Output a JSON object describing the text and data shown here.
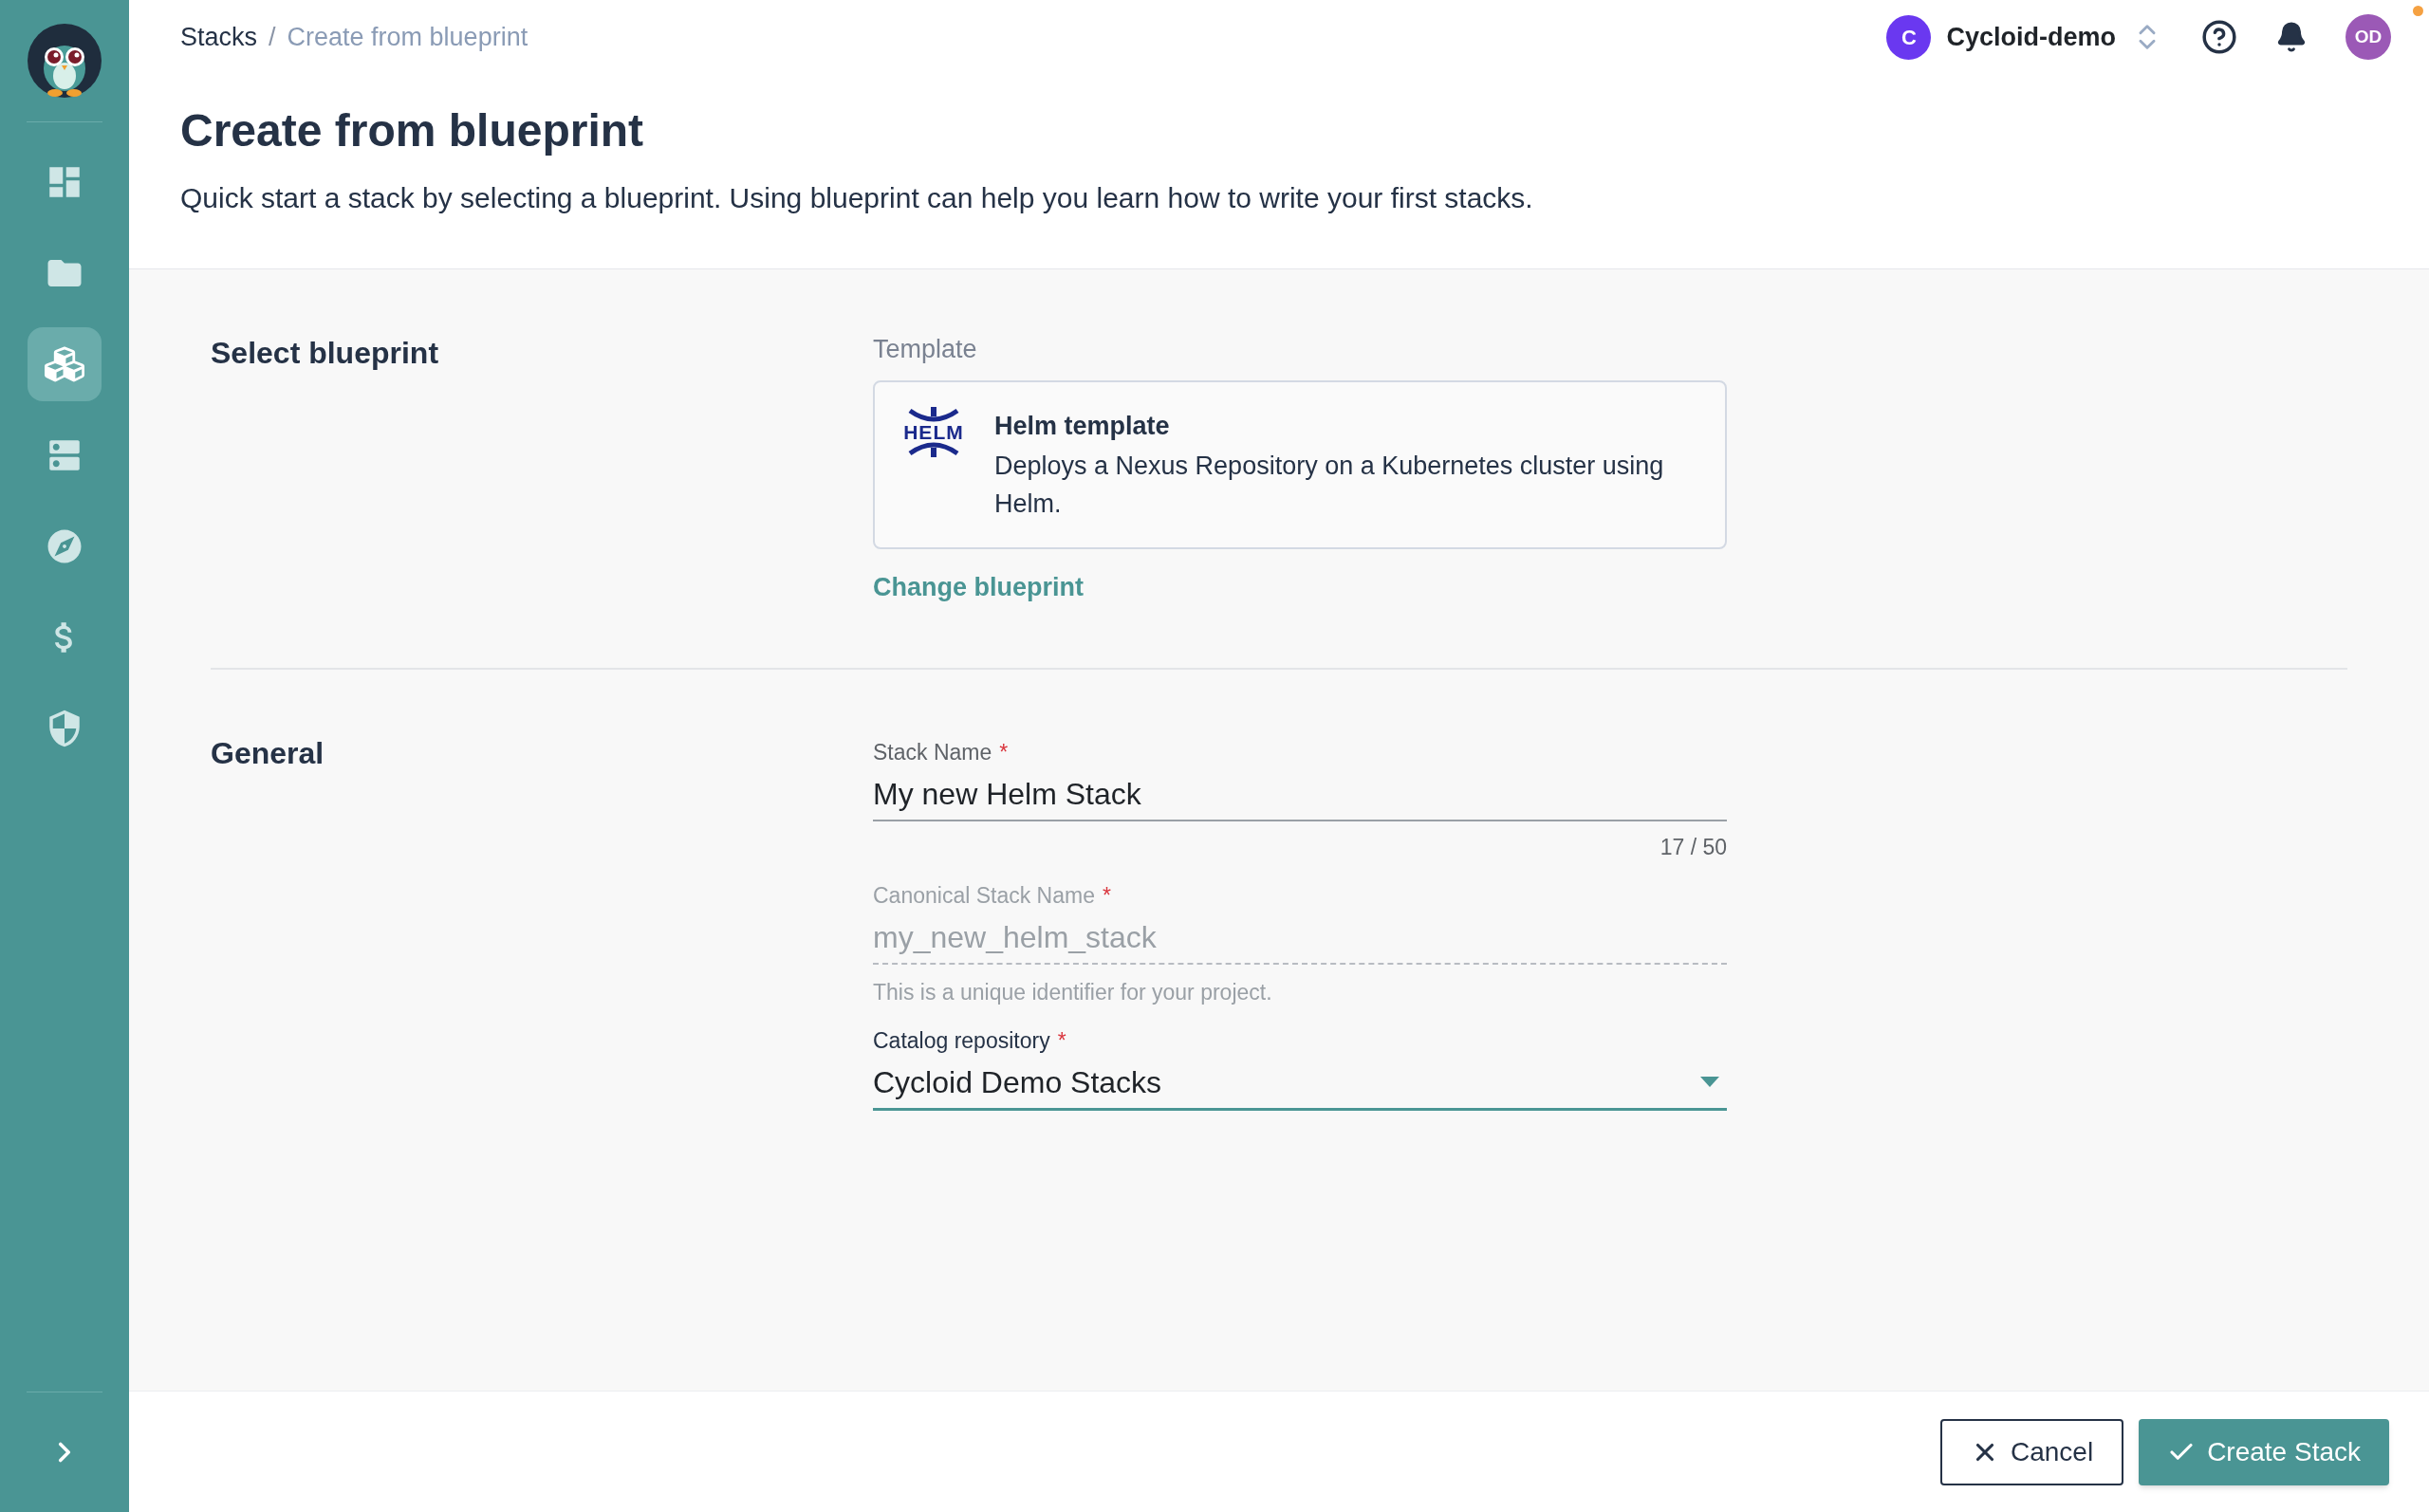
{
  "sidebar": {
    "items": [
      {
        "selected": false
      },
      {
        "selected": false
      },
      {
        "selected": true
      },
      {
        "selected": false
      },
      {
        "selected": false
      },
      {
        "selected": false
      },
      {
        "selected": false
      }
    ]
  },
  "breadcrumb": [
    "Stacks",
    "Create from blueprint"
  ],
  "breadcrumb_separator": "/",
  "required_mark": "*",
  "organization": {
    "initial": "C",
    "name": "Cycloid-demo",
    "color": "#6a38f0"
  },
  "user": {
    "initials": "OD",
    "color": "#9b59b6"
  },
  "page": {
    "title": "Create from blueprint",
    "description": "Quick start a stack by selecting a blueprint. Using blueprint can help you learn how to write your first stacks."
  },
  "sections": [
    {
      "title": "Select blueprint",
      "kind": "blueprint",
      "label": "Template",
      "blueprint": {
        "logo_text": "HELM",
        "name": "Helm template",
        "description": "Deploys a Nexus Repository on a Kubernetes cluster using Helm."
      },
      "link": "Change blueprint"
    },
    {
      "title": "General",
      "kind": "form",
      "fields": [
        {
          "kind": "text",
          "label": "Stack Name",
          "required": true,
          "value": "My new Helm Stack",
          "counter": "17 / 50",
          "disabled": false
        },
        {
          "kind": "text",
          "label": "Canonical Stack Name",
          "required": true,
          "value": "my_new_helm_stack",
          "hint": "This is a unique identifier for your project.",
          "disabled": true
        },
        {
          "kind": "select",
          "label": "Catalog repository",
          "required": true,
          "value": "Cycloid Demo Stacks",
          "disabled": false,
          "focused": true
        }
      ]
    }
  ],
  "footer": {
    "cancel": "Cancel",
    "submit": "Create Stack"
  }
}
